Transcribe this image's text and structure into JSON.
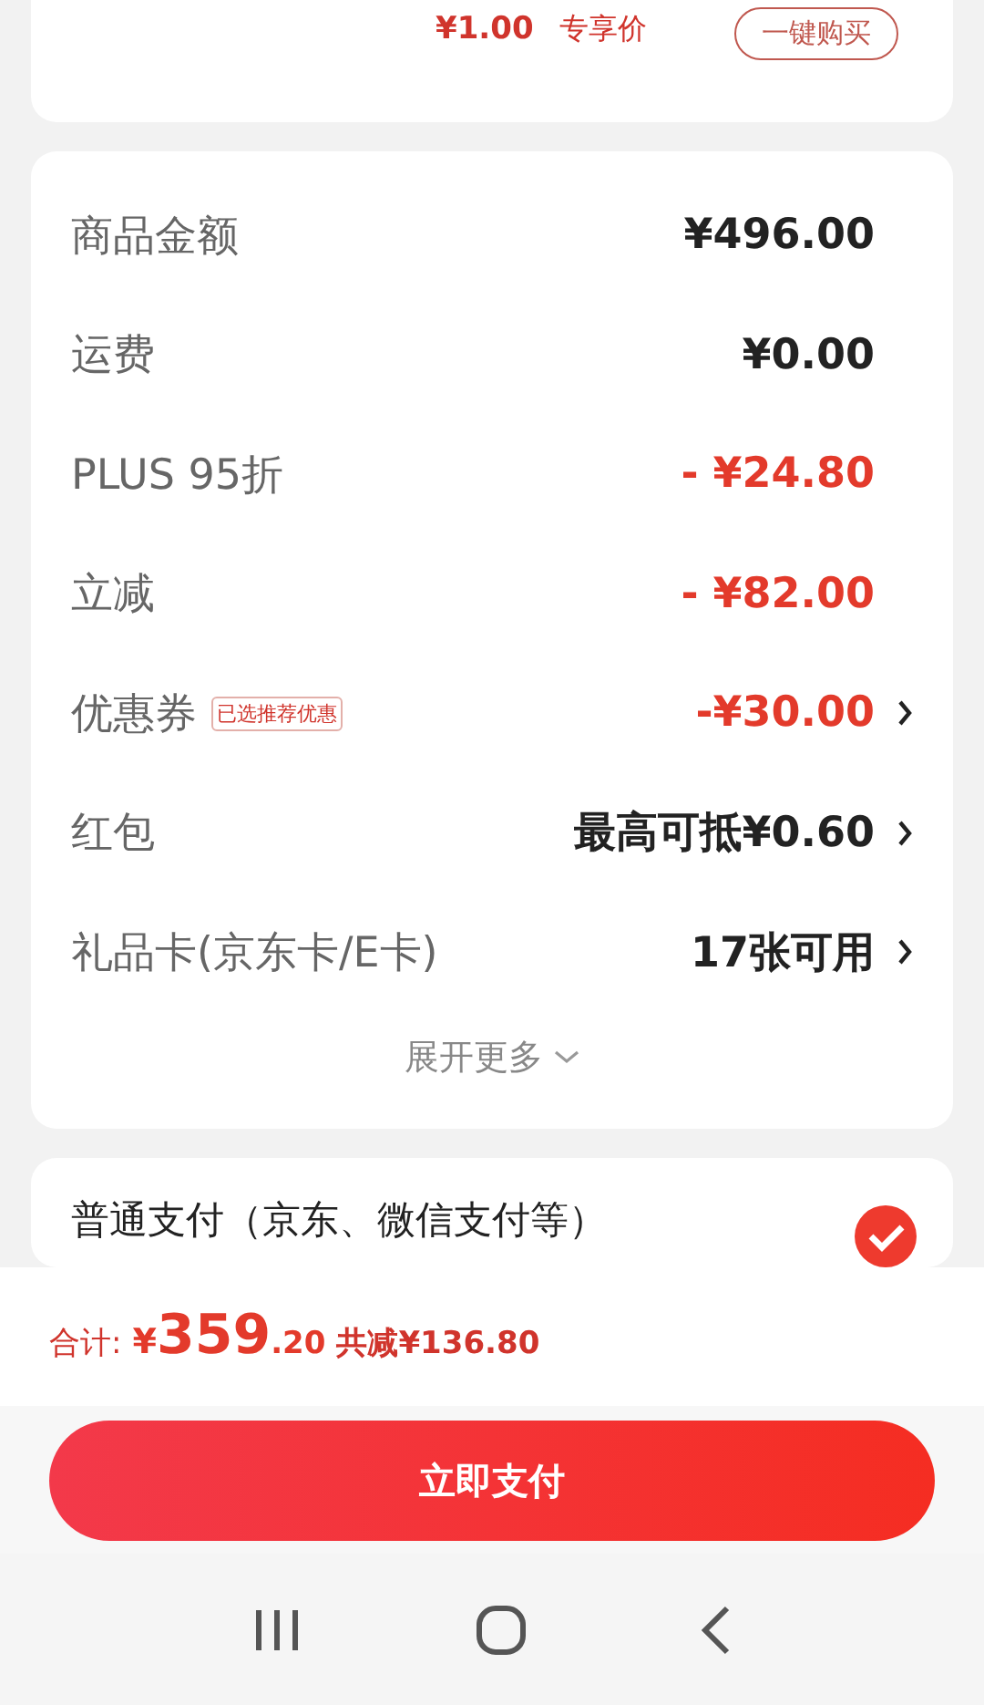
{
  "top_offer": {
    "price": "¥1.00",
    "price_label": "专享价",
    "buy_button": "一键购买"
  },
  "summary": {
    "rows": [
      {
        "label": "商品金额",
        "value": "¥496.00",
        "discount": false,
        "arrow": false
      },
      {
        "label": "运费",
        "value": "¥0.00",
        "discount": false,
        "arrow": false
      },
      {
        "label": "PLUS 95折",
        "value": "- ¥24.80",
        "discount": true,
        "arrow": false
      },
      {
        "label": "立减",
        "value": "- ¥82.00",
        "discount": true,
        "arrow": false
      },
      {
        "label": "优惠券",
        "tag": "已选推荐优惠",
        "value": "-¥30.00",
        "discount": true,
        "arrow": true
      },
      {
        "label": "红包",
        "value": "最高可抵¥0.60",
        "discount": false,
        "arrow": true
      },
      {
        "label": "礼品卡(京东卡/E卡)",
        "value": "17张可用",
        "discount": false,
        "arrow": true
      }
    ],
    "expand": "展开更多"
  },
  "payment": {
    "label": "普通支付（京东、微信支付等）",
    "selected": true
  },
  "footer": {
    "total_label": "合计:",
    "currency": "¥",
    "total_integer": "359",
    "total_decimal": ".20",
    "saving": "共减¥136.80",
    "pay_button": "立即支付"
  }
}
